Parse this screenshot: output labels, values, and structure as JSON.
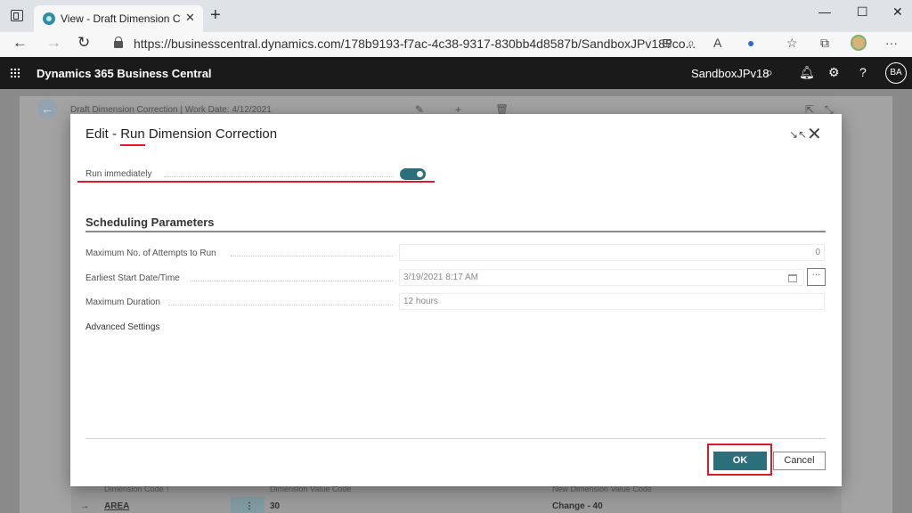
{
  "browser": {
    "tab_title": "View - Draft Dimension Correction",
    "url": "https://businesscentral.dynamics.com/178b9193-f7ac-4c38-9317-830bb4d8587b/SandboxJPv18?co..."
  },
  "app": {
    "title": "Dynamics 365 Business Central",
    "company": "SandboxJPv18",
    "user_initials": "BA"
  },
  "background_page": {
    "caption": "Draft Dimension Correction | Work Date: 4/12/2021",
    "columns": [
      "Dimension Code ↑",
      "Dimension Value Code",
      "New Dimension Value Code"
    ],
    "row": {
      "code": "AREA",
      "value": "30",
      "new_value": "Change - 40"
    }
  },
  "dialog": {
    "title_prefix": "Edit - ",
    "title_run": "Run",
    "title_suffix": " Dimension Correction",
    "run_immediately_label": "Run immediately",
    "run_immediately": true,
    "section_title": "Scheduling Parameters",
    "fields": {
      "max_attempts_label": "Maximum No. of Attempts to Run",
      "max_attempts_value": "0",
      "earliest_start_label": "Earliest Start Date/Time",
      "earliest_start_value": "3/19/2021 8:17 AM",
      "max_duration_label": "Maximum Duration",
      "max_duration_value": "12 hours"
    },
    "advanced_settings": "Advanced Settings",
    "ok_label": "OK",
    "cancel_label": "Cancel",
    "more_label": "···"
  },
  "colors": {
    "accent": "#2a6f7a",
    "highlight": "#e0192a",
    "appbar": "#1a1a1a"
  }
}
